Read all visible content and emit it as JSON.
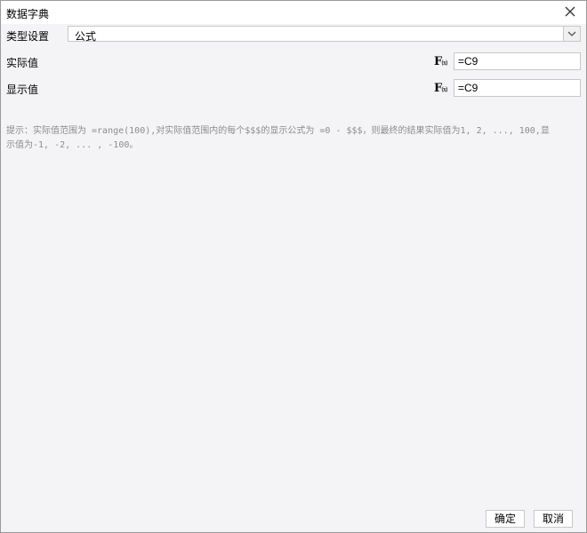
{
  "dialog": {
    "title": "数据字典",
    "close_icon": "close-icon"
  },
  "type_setting": {
    "label": "类型设置",
    "selected": "公式",
    "dropdown_icon": "chevron-down-icon"
  },
  "actual_value": {
    "label": "实际值",
    "fx_icon": "function-icon",
    "value": "=C9"
  },
  "display_value": {
    "label": "显示值",
    "fx_icon": "function-icon",
    "value": "=C9"
  },
  "hint": {
    "text": "提示：实际值范围为 =range(100),对实际值范围内的每个$$$的显示公式为 =0 - $$$，则最终的结果实际值为1, 2, ..., 100,显示值为-1, -2, ... , -100。"
  },
  "buttons": {
    "ok": "确定",
    "cancel": "取消"
  },
  "colors": {
    "dialog_bg": "#f4f4f6",
    "hint_text": "#8c8c8c",
    "border": "#c8c8c8"
  }
}
